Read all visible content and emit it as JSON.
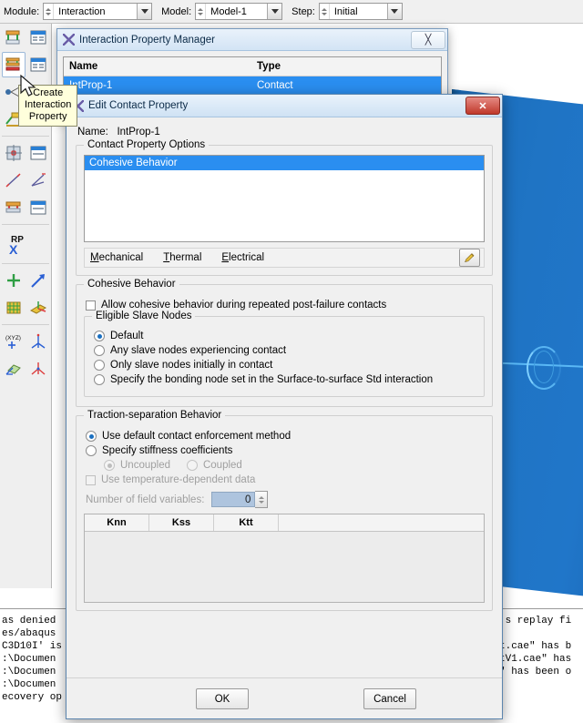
{
  "topbar": {
    "module_label": "Module:",
    "module_value": "Interaction",
    "model_label": "Model:",
    "model_value": "Model-1",
    "step_label": "Step:",
    "step_value": "Initial"
  },
  "tooltip": {
    "line1": "Create",
    "line2": "Interaction",
    "line3": "Property"
  },
  "property_manager": {
    "title": "Interaction Property Manager",
    "close_label": "╳",
    "columns": [
      "Name",
      "Type"
    ],
    "rows": [
      {
        "name": "IntProp-1",
        "type": "Contact"
      }
    ]
  },
  "edit_dialog": {
    "title": "Edit Contact Property",
    "close_label": "✕",
    "name_label": "Name:",
    "name_value": "IntProp-1",
    "options_group_label": "Contact Property Options",
    "options_list": [
      "Cohesive Behavior"
    ],
    "menu": [
      {
        "label": "Mechanical",
        "accel": "M"
      },
      {
        "label": "Thermal",
        "accel": "T"
      },
      {
        "label": "Electrical",
        "accel": "E"
      }
    ],
    "edit_icon": "pencil-icon",
    "cohesive": {
      "group_label": "Cohesive Behavior",
      "allow_checkbox": "Allow cohesive behavior during repeated post-failure contacts",
      "allow_checked": false,
      "slave_group_label": "Eligible Slave Nodes",
      "slave_options": [
        "Default",
        "Any slave nodes experiencing contact",
        "Only slave nodes initially in contact",
        "Specify the bonding node set in the Surface-to-surface Std interaction"
      ],
      "slave_selected": 0
    },
    "traction": {
      "group_label": "Traction-separation Behavior",
      "options": [
        "Use default contact enforcement method",
        "Specify stiffness coefficients"
      ],
      "selected": 0,
      "coupling_options": [
        "Uncoupled",
        "Coupled"
      ],
      "coupling_selected": 0,
      "temp_dependent_label": "Use temperature-dependent data",
      "temp_dependent_checked": false,
      "field_vars_label": "Number of field variables:",
      "field_vars_value": "0",
      "table_columns": [
        "Knn",
        "Kss",
        "Ktt"
      ],
      "table_rows": []
    },
    "ok_label": "OK",
    "cancel_label": "Cancel"
  },
  "messages": {
    "left_lines": [
      "as denied",
      "es/abaqus",
      "C3D10I' is",
      ":\\Documen",
      ":\\Documen",
      ":\\Documen",
      "ecovery op"
    ],
    "right_lines": [
      "'s replay fi",
      "",
      "t.cae\" has b",
      "tV1.cae\" has",
      "\" has been o"
    ]
  },
  "colors": {
    "accent_blue": "#2a8ef0",
    "model_blue": "#1f74c4",
    "tooltip_bg": "#ffffdc",
    "close_red": "#c0392b"
  }
}
